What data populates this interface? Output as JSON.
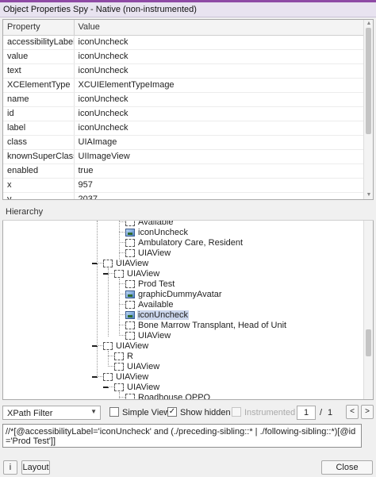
{
  "window": {
    "title": "Object Properties Spy - Native (non-instrumented)"
  },
  "properties": {
    "headers": [
      "Property",
      "Value"
    ],
    "rows": [
      [
        "accessibilityLabel",
        "iconUncheck"
      ],
      [
        "value",
        "iconUncheck"
      ],
      [
        "text",
        "iconUncheck"
      ],
      [
        "XCElementType",
        "XCUIElementTypeImage"
      ],
      [
        "name",
        "iconUncheck"
      ],
      [
        "id",
        "iconUncheck"
      ],
      [
        "label",
        "iconUncheck"
      ],
      [
        "class",
        "UIAImage"
      ],
      [
        "knownSuperClass",
        "UIImageView"
      ],
      [
        "enabled",
        "true"
      ],
      [
        "x",
        "957"
      ],
      [
        "y",
        "2037"
      ]
    ]
  },
  "hierarchy": {
    "label": "Hierarchy",
    "nodes": [
      {
        "text": "Available",
        "icon": "box"
      },
      {
        "text": "iconUncheck",
        "icon": "image"
      },
      {
        "text": "Ambulatory Care, Resident",
        "icon": "box"
      },
      {
        "text": "UIAView",
        "icon": "box"
      },
      {
        "text": "UIAView",
        "icon": "box"
      },
      {
        "text": "UIAView",
        "icon": "box"
      },
      {
        "text": "Prod Test",
        "icon": "box"
      },
      {
        "text": "graphicDummyAvatar",
        "icon": "image"
      },
      {
        "text": "Available",
        "icon": "box"
      },
      {
        "text": "iconUncheck",
        "icon": "image",
        "selected": true
      },
      {
        "text": "Bone Marrow Transplant, Head of Unit",
        "icon": "box"
      },
      {
        "text": "UIAView",
        "icon": "box"
      },
      {
        "text": "UIAView",
        "icon": "box"
      },
      {
        "text": "R",
        "icon": "box"
      },
      {
        "text": "UIAView",
        "icon": "box"
      },
      {
        "text": "UIAView",
        "icon": "box"
      },
      {
        "text": "UIAView",
        "icon": "box"
      },
      {
        "text": "Roadhouse OPPO",
        "icon": "box"
      }
    ]
  },
  "filter_bar": {
    "combo_value": "XPath Filter",
    "simple_view_label": "Simple View",
    "simple_view_checked": false,
    "show_hidden_label": "Show hidden",
    "show_hidden_checked": true,
    "instrumented_label": "Instrumented",
    "instrumented_checked": false,
    "page_current": "1",
    "page_separator": "/",
    "page_total": "1",
    "prev_label": "<",
    "next_label": ">"
  },
  "xpath": {
    "value": "//*[@accessibilityLabel='iconUncheck' and (./preceding-sibling::* | ./following-sibling::*)[@id='Prod Test']]"
  },
  "footer": {
    "info_label": "i",
    "layout_label": "Layout",
    "close_label": "Close"
  },
  "scroll": {
    "properties_position": 0.0,
    "properties_visible_fraction": 0.65,
    "tree_position": 0.72,
    "tree_visible_fraction": 0.15
  },
  "icons": {
    "checked_mark": "✓",
    "combo_arrow": "▼",
    "scroll_up": "▲",
    "scroll_down": "▼"
  }
}
